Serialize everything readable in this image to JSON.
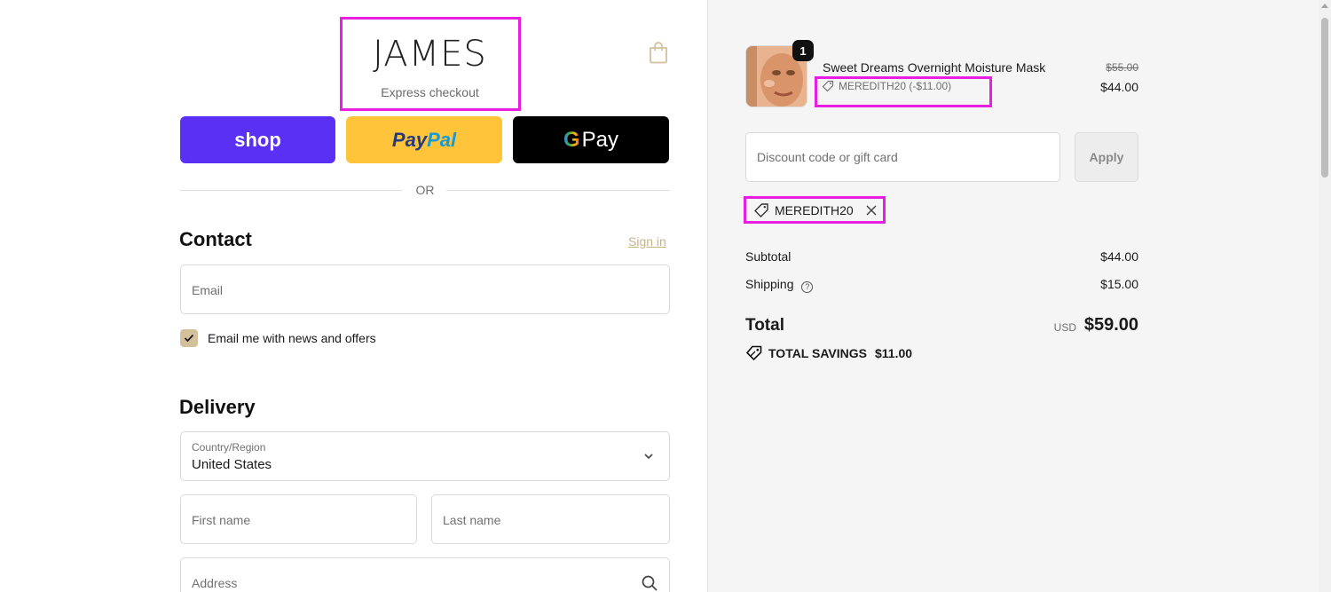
{
  "brand": {
    "logo_text": "JAMES",
    "express_label": "Express checkout"
  },
  "express_buttons": {
    "shop": "shop",
    "paypal_a": "Pay",
    "paypal_b": "Pal",
    "gpay_g": "G",
    "gpay_text": "Pay"
  },
  "divider": {
    "or": "OR"
  },
  "contact": {
    "heading": "Contact",
    "signin": "Sign in",
    "email_placeholder": "Email",
    "news_label": "Email me with news and offers",
    "news_checked": true
  },
  "delivery": {
    "heading": "Delivery",
    "country_label": "Country/Region",
    "country_value": "United States",
    "first_name_placeholder": "First name",
    "last_name_placeholder": "Last name",
    "address_placeholder": "Address"
  },
  "cart": {
    "quantity": "1",
    "product_name": "Sweet Dreams Overnight Moisture Mask",
    "product_discount": "MEREDITH20 (-$11.00)",
    "original_price": "$55.00",
    "price": "$44.00"
  },
  "discount": {
    "placeholder": "Discount code or gift card",
    "apply_label": "Apply",
    "applied_code": "MEREDITH20"
  },
  "summary": {
    "subtotal_label": "Subtotal",
    "subtotal_value": "$44.00",
    "shipping_label": "Shipping",
    "shipping_value": "$15.00",
    "total_label": "Total",
    "currency": "USD",
    "total_value": "$59.00",
    "savings_label": "TOTAL SAVINGS",
    "savings_value": "$11.00"
  },
  "colors": {
    "accent": "#d4c19c",
    "shop_purple": "#5a31f4",
    "paypal_yellow": "#ffc439",
    "highlight": "#e81ee0"
  },
  "icons": [
    "shopping-bag-icon",
    "checkmark-icon",
    "chevron-down-icon",
    "search-icon",
    "tag-icon",
    "close-icon",
    "help-icon"
  ]
}
